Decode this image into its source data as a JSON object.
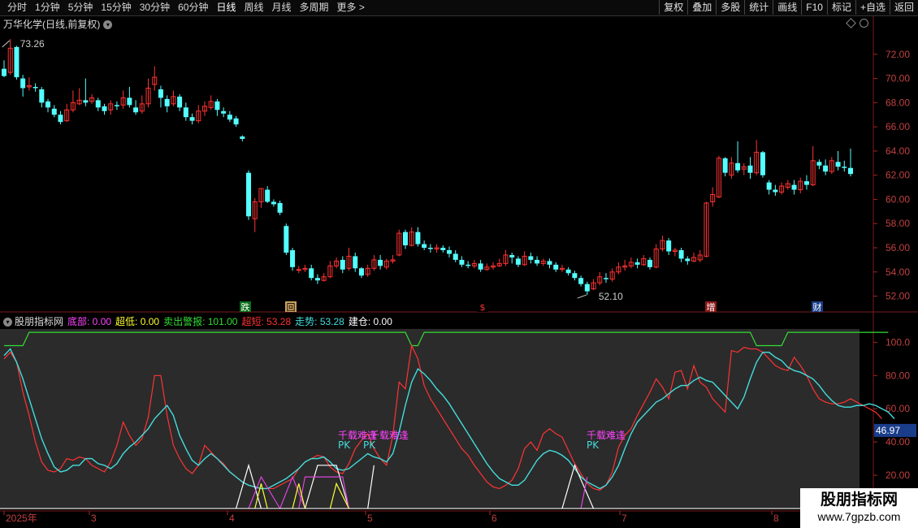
{
  "toolbar": {
    "periods": [
      "分时",
      "1分钟",
      "5分钟",
      "15分钟",
      "30分钟",
      "60分钟",
      "日线",
      "周线",
      "月线",
      "多周期",
      "更多 >"
    ],
    "active": "日线",
    "buttons": [
      "复权",
      "叠加",
      "多股",
      "统计",
      "画线",
      "F10",
      "标记",
      "+自选",
      "返回"
    ]
  },
  "stock": {
    "title": "万华化学(日线,前复权)"
  },
  "price_axis": [
    "72.00",
    "70.00",
    "68.00",
    "66.00",
    "64.00",
    "62.00",
    "60.00",
    "58.00",
    "56.00",
    "54.00",
    "52.00"
  ],
  "ind_axis": [
    "100.0",
    "80.00",
    "60.00",
    "40.00",
    "20.00"
  ],
  "ind_current": "46.97",
  "high_label": "73.26",
  "low_label": "52.10",
  "event_marks": [
    "跌",
    "回",
    "$",
    "增",
    "财"
  ],
  "date_labels": [
    "2025年",
    "3",
    "4",
    "5",
    "6",
    "7",
    "8"
  ],
  "indicator": {
    "name": "股朋指标网",
    "items": [
      {
        "label": "底部:",
        "value": "0.00",
        "color": "#ff44ff"
      },
      {
        "label": "超低:",
        "value": "0.00",
        "color": "#ffff33"
      },
      {
        "label": "卖出警报:",
        "value": "101.00",
        "color": "#33dd33"
      },
      {
        "label": "超短:",
        "value": "53.28",
        "color": "#ff3333"
      },
      {
        "label": "走势:",
        "value": "53.28",
        "color": "#44dddd"
      },
      {
        "label": "建仓:",
        "value": "0.00",
        "color": "#ffffff"
      }
    ]
  },
  "annotations": [
    "千载难逢",
    "千载难逢",
    "千载难逢",
    "PK",
    "PK",
    "PK"
  ],
  "watermark": {
    "line1": "股朋指标网",
    "line2": "www.7gpzb.com"
  },
  "colors": {
    "up": "#ff3333",
    "down": "#54ffff",
    "bg": "#000000",
    "panel": "#2b2b2b"
  },
  "chart_data": {
    "type": "candlestick",
    "price_range": [
      51.5,
      73.8
    ],
    "candles": [
      [
        70.8,
        70.2,
        71.5,
        70.1
      ],
      [
        70.5,
        72.5,
        73.26,
        70.3
      ],
      [
        72.6,
        70.1,
        72.7,
        69.9
      ],
      [
        70.0,
        69.2,
        70.3,
        68.5
      ],
      [
        69.3,
        69.4,
        70.1,
        69.0
      ],
      [
        69.3,
        69.2,
        69.6,
        68.9
      ],
      [
        69.1,
        68.0,
        69.3,
        67.6
      ],
      [
        68.1,
        67.6,
        68.3,
        67.2
      ],
      [
        67.5,
        67.0,
        67.8,
        66.8
      ],
      [
        67.0,
        66.4,
        67.3,
        66.2
      ],
      [
        66.5,
        67.4,
        67.9,
        66.4
      ],
      [
        67.4,
        68.0,
        69.0,
        67.2
      ],
      [
        67.9,
        68.2,
        69.2,
        67.8
      ],
      [
        68.2,
        68.0,
        70.0,
        67.7
      ],
      [
        68.1,
        68.4,
        68.7,
        67.9
      ],
      [
        68.2,
        67.6,
        68.4,
        67.3
      ],
      [
        67.7,
        67.3,
        67.9,
        67.0
      ],
      [
        67.4,
        67.9,
        68.2,
        67.0
      ],
      [
        67.8,
        67.7,
        68.1,
        67.4
      ],
      [
        67.8,
        68.4,
        69.0,
        67.5
      ],
      [
        68.4,
        67.8,
        69.3,
        67.6
      ],
      [
        67.6,
        67.2,
        68.2,
        67.0
      ],
      [
        67.3,
        67.9,
        68.6,
        67.1
      ],
      [
        67.9,
        69.2,
        70.0,
        67.6
      ],
      [
        69.5,
        70.1,
        71.0,
        69.0
      ],
      [
        69.1,
        68.4,
        69.4,
        67.6
      ],
      [
        68.3,
        67.7,
        68.6,
        67.2
      ],
      [
        67.9,
        68.5,
        69.0,
        67.7
      ],
      [
        68.5,
        67.6,
        68.7,
        67.3
      ],
      [
        67.6,
        66.8,
        68.0,
        66.5
      ],
      [
        66.8,
        66.5,
        67.1,
        66.2
      ],
      [
        66.5,
        67.3,
        67.8,
        66.3
      ],
      [
        67.3,
        67.7,
        68.1,
        66.9
      ],
      [
        67.6,
        68.1,
        68.6,
        67.4
      ],
      [
        68.1,
        67.4,
        68.3,
        66.9
      ],
      [
        67.3,
        67.1,
        67.6,
        66.8
      ],
      [
        67.0,
        66.6,
        67.3,
        66.4
      ],
      [
        66.7,
        66.2,
        66.9,
        66.0
      ],
      [
        65.2,
        65.0,
        65.3,
        64.8
      ],
      [
        62.2,
        58.6,
        62.4,
        58.3
      ],
      [
        58.4,
        59.8,
        60.1,
        57.3
      ],
      [
        59.8,
        60.9,
        60.9,
        59.3
      ],
      [
        60.8,
        59.8,
        61.1,
        59.7
      ],
      [
        59.8,
        59.6,
        60.0,
        59.4
      ],
      [
        59.7,
        58.9,
        59.9,
        58.7
      ],
      [
        57.8,
        55.6,
        58.0,
        55.4
      ],
      [
        55.8,
        54.4,
        56.0,
        54.1
      ],
      [
        54.2,
        54.2,
        54.5,
        53.9
      ],
      [
        54.2,
        54.3,
        54.6,
        54.0
      ],
      [
        54.3,
        53.5,
        54.6,
        53.3
      ],
      [
        53.5,
        53.3,
        53.8,
        53.0
      ],
      [
        53.3,
        53.6,
        53.9,
        53.2
      ],
      [
        53.6,
        54.5,
        54.9,
        53.5
      ],
      [
        54.5,
        54.9,
        55.2,
        54.3
      ],
      [
        55.0,
        54.2,
        55.3,
        53.9
      ],
      [
        54.3,
        55.3,
        56.0,
        54.1
      ],
      [
        55.3,
        54.3,
        55.6,
        54.0
      ],
      [
        54.3,
        53.7,
        54.4,
        53.5
      ],
      [
        53.8,
        54.3,
        54.6,
        53.6
      ],
      [
        54.3,
        55.0,
        55.4,
        54.1
      ],
      [
        55.0,
        54.5,
        55.4,
        54.2
      ],
      [
        54.4,
        54.9,
        55.1,
        54.2
      ],
      [
        54.9,
        55.0,
        55.4,
        54.7
      ],
      [
        55.4,
        57.2,
        57.5,
        55.3
      ],
      [
        57.3,
        56.2,
        57.5,
        55.9
      ],
      [
        56.2,
        57.3,
        57.7,
        56.1
      ],
      [
        57.3,
        56.3,
        57.7,
        56.1
      ],
      [
        56.3,
        56.0,
        56.6,
        55.8
      ],
      [
        56.0,
        55.9,
        56.3,
        55.6
      ],
      [
        55.9,
        56.0,
        56.3,
        55.6
      ],
      [
        56.0,
        55.8,
        56.2,
        55.6
      ],
      [
        55.8,
        55.5,
        56.1,
        55.2
      ],
      [
        55.5,
        55.0,
        55.8,
        54.8
      ],
      [
        55.0,
        54.6,
        55.3,
        54.4
      ],
      [
        54.6,
        54.5,
        54.9,
        54.3
      ],
      [
        54.5,
        54.7,
        55.0,
        54.3
      ],
      [
        54.7,
        54.2,
        55.0,
        54.0
      ],
      [
        54.2,
        54.4,
        54.7,
        54.1
      ],
      [
        54.4,
        54.5,
        54.8,
        54.2
      ],
      [
        54.5,
        54.7,
        55.1,
        54.4
      ],
      [
        54.7,
        55.4,
        55.8,
        54.5
      ],
      [
        55.4,
        55.2,
        55.6,
        54.7
      ],
      [
        55.1,
        54.6,
        55.3,
        54.4
      ],
      [
        54.6,
        55.3,
        55.7,
        54.5
      ],
      [
        55.3,
        55.0,
        55.6,
        54.7
      ],
      [
        55.0,
        54.7,
        55.3,
        54.5
      ],
      [
        54.7,
        54.9,
        55.1,
        54.5
      ],
      [
        54.9,
        54.6,
        55.1,
        54.3
      ],
      [
        54.6,
        54.2,
        54.8,
        54.0
      ],
      [
        54.2,
        54.3,
        54.6,
        54.0
      ],
      [
        54.2,
        53.9,
        54.4,
        53.7
      ],
      [
        53.9,
        53.5,
        54.1,
        53.3
      ],
      [
        53.5,
        53.0,
        53.7,
        52.8
      ],
      [
        53.0,
        52.4,
        53.2,
        52.1
      ],
      [
        52.6,
        53.1,
        53.4,
        52.5
      ],
      [
        53.1,
        53.6,
        54.0,
        52.9
      ],
      [
        53.5,
        53.4,
        53.9,
        53.1
      ],
      [
        53.4,
        54.0,
        54.3,
        53.2
      ],
      [
        54.0,
        54.4,
        54.8,
        53.8
      ],
      [
        54.4,
        54.5,
        55.0,
        54.1
      ],
      [
        54.5,
        54.8,
        55.2,
        54.3
      ],
      [
        54.8,
        54.6,
        55.1,
        54.3
      ],
      [
        54.6,
        55.1,
        55.4,
        54.5
      ],
      [
        55.0,
        54.4,
        55.2,
        54.2
      ],
      [
        54.4,
        55.9,
        56.3,
        54.3
      ],
      [
        55.9,
        56.6,
        57.0,
        55.7
      ],
      [
        56.6,
        55.7,
        56.8,
        55.4
      ],
      [
        55.7,
        55.8,
        56.0,
        55.3
      ],
      [
        55.8,
        55.1,
        56.0,
        54.8
      ],
      [
        55.1,
        54.9,
        55.3,
        54.6
      ],
      [
        54.9,
        55.2,
        55.6,
        54.8
      ],
      [
        55.0,
        55.4,
        55.8,
        54.8
      ],
      [
        55.3,
        59.7,
        59.8,
        55.2
      ],
      [
        59.8,
        60.4,
        61.0,
        59.4
      ],
      [
        60.2,
        63.4,
        63.6,
        60.1
      ],
      [
        63.4,
        62.2,
        63.5,
        61.9
      ],
      [
        62.0,
        63.0,
        63.5,
        61.7
      ],
      [
        63.0,
        62.4,
        64.8,
        62.2
      ],
      [
        62.5,
        62.7,
        63.0,
        62.0
      ],
      [
        62.8,
        62.2,
        63.5,
        61.7
      ],
      [
        62.2,
        63.9,
        64.9,
        62.0
      ],
      [
        63.9,
        62.0,
        64.0,
        61.8
      ],
      [
        61.4,
        60.8,
        61.6,
        60.4
      ],
      [
        60.8,
        60.6,
        61.2,
        60.3
      ],
      [
        60.6,
        61.1,
        61.4,
        60.4
      ],
      [
        61.0,
        61.3,
        61.6,
        60.8
      ],
      [
        61.2,
        60.8,
        61.6,
        60.4
      ],
      [
        60.8,
        61.5,
        61.8,
        60.5
      ],
      [
        61.5,
        61.2,
        62.0,
        60.8
      ],
      [
        61.2,
        63.2,
        64.4,
        61.1
      ],
      [
        63.1,
        62.8,
        63.3,
        62.5
      ],
      [
        62.8,
        62.3,
        63.3,
        62.0
      ],
      [
        62.3,
        63.2,
        63.5,
        62.1
      ],
      [
        63.1,
        62.7,
        64.0,
        62.4
      ],
      [
        62.7,
        62.6,
        63.2,
        62.3
      ],
      [
        62.6,
        62.1,
        64.2,
        61.9
      ]
    ],
    "ind_range": [
      0,
      108
    ],
    "zoushi": [
      92,
      96,
      88,
      78,
      66,
      54,
      42,
      33,
      25,
      22,
      23,
      26,
      26,
      30,
      30,
      27,
      26,
      24,
      27,
      33,
      37,
      40,
      44,
      48,
      54,
      58,
      62,
      56,
      44,
      36,
      29,
      26,
      30,
      33,
      30,
      26,
      22,
      19,
      16,
      14,
      13,
      12,
      12,
      14,
      16,
      18,
      21,
      24,
      28,
      30,
      30,
      31,
      28,
      24,
      23,
      24,
      27,
      30,
      33,
      31,
      30,
      28,
      33,
      46,
      62,
      76,
      84,
      81,
      77,
      72,
      68,
      63,
      57,
      51,
      45,
      39,
      33,
      27,
      22,
      18,
      16,
      14,
      14,
      17,
      23,
      29,
      33,
      35,
      34,
      32,
      29,
      24,
      19,
      16,
      14,
      12,
      14,
      19,
      26,
      36,
      45,
      52,
      56,
      60,
      64,
      66,
      69,
      72,
      74,
      74,
      77,
      79,
      77,
      76,
      72,
      68,
      64,
      60,
      67,
      78,
      88,
      94,
      94,
      91,
      89,
      85,
      83,
      82,
      80,
      78,
      74,
      69,
      65,
      62,
      61,
      61,
      62,
      62,
      63,
      62,
      60,
      58,
      54
    ],
    "chaoduan": [
      90,
      94,
      88,
      70,
      56,
      40,
      28,
      23,
      22,
      24,
      30,
      29,
      31,
      30,
      26,
      24,
      22,
      28,
      38,
      52,
      44,
      38,
      42,
      55,
      80,
      80,
      56,
      38,
      30,
      24,
      21,
      26,
      38,
      34,
      30,
      27,
      22,
      19,
      16,
      14,
      13,
      12,
      12,
      12,
      14,
      16,
      18,
      24,
      28,
      30,
      32,
      31,
      25,
      22,
      21,
      27,
      36,
      41,
      45,
      36,
      30,
      26,
      44,
      76,
      72,
      98,
      90,
      74,
      66,
      60,
      54,
      48,
      42,
      36,
      32,
      26,
      21,
      16,
      13,
      12,
      14,
      17,
      24,
      36,
      40,
      35,
      45,
      48,
      45,
      43,
      35,
      27,
      21,
      15,
      12,
      11,
      14,
      22,
      37,
      44,
      48,
      56,
      63,
      70,
      78,
      73,
      66,
      82,
      83,
      72,
      86,
      76,
      73,
      66,
      62,
      58,
      95,
      94,
      97,
      96,
      96,
      94,
      90,
      86,
      84,
      83,
      91,
      86,
      80,
      72,
      66,
      64,
      63,
      63,
      64,
      66,
      64,
      62,
      60,
      58,
      54
    ],
    "alarm": [
      98,
      98,
      98,
      98,
      106,
      106,
      106,
      106,
      106,
      106,
      106,
      106,
      106,
      106,
      106,
      106,
      106,
      106,
      106,
      106,
      106,
      106,
      106,
      106,
      106,
      106,
      106,
      106,
      106,
      106,
      106,
      106,
      106,
      106,
      106,
      106,
      106,
      106,
      106,
      106,
      106,
      106,
      106,
      106,
      106,
      106,
      106,
      106,
      106,
      106,
      106,
      106,
      106,
      106,
      106,
      106,
      106,
      106,
      106,
      106,
      106,
      106,
      106,
      106,
      106,
      98,
      98,
      106,
      106,
      106,
      106,
      106,
      106,
      106,
      106,
      106,
      106,
      106,
      106,
      106,
      106,
      106,
      106,
      106,
      106,
      106,
      106,
      106,
      106,
      106,
      106,
      106,
      106,
      106,
      106,
      106,
      106,
      106,
      106,
      106,
      106,
      106,
      106,
      106,
      106,
      106,
      106,
      106,
      106,
      106,
      106,
      106,
      106,
      106,
      106,
      106,
      106,
      106,
      106,
      106,
      98,
      98,
      98,
      98,
      98,
      106,
      106,
      106,
      106,
      106,
      106,
      106,
      106,
      106,
      106,
      106,
      106,
      106,
      106,
      106,
      106,
      106
    ],
    "jiancang": [
      [
        37,
        39,
        41
      ],
      [
        48,
        50,
        53,
        55
      ],
      [
        58,
        59
      ],
      [
        89,
        91,
        94
      ]
    ],
    "dibu": [
      [
        39,
        41,
        44
      ],
      [
        44,
        46,
        48
      ],
      [
        47,
        48,
        54,
        55
      ],
      [
        92,
        93
      ]
    ],
    "chaodi": [
      [
        40,
        41,
        42
      ],
      [
        46,
        47,
        48
      ],
      [
        52,
        53,
        55
      ]
    ]
  }
}
